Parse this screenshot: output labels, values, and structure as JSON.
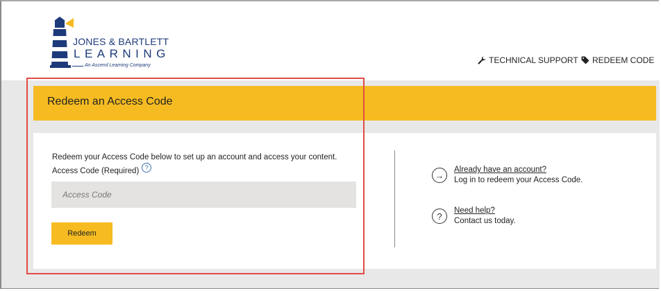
{
  "brand": {
    "line1": "JONES & BARTLETT",
    "line2": "LEARNING",
    "tagline": "An Ascend Learning Company",
    "primary_color": "#1d3a7a",
    "accent_color": "#f5bb21"
  },
  "nav": {
    "support_label": "TECHNICAL SUPPORT",
    "support_icon": "wrench-icon",
    "redeem_label": "REDEEM CODE",
    "redeem_icon": "tag-icon"
  },
  "banner": {
    "title": "Redeem an Access Code"
  },
  "form": {
    "intro": "Redeem your Access Code below to set up an account and access your content.",
    "field_label": "Access Code (Required)",
    "placeholder": "Access Code",
    "button_label": "Redeem"
  },
  "side": {
    "account_link": "Already have an account?",
    "account_text": "Log in to redeem your Access Code.",
    "help_link": "Need help?",
    "help_text": "Contact us today."
  },
  "annotation": {
    "color": "#e04b43"
  }
}
